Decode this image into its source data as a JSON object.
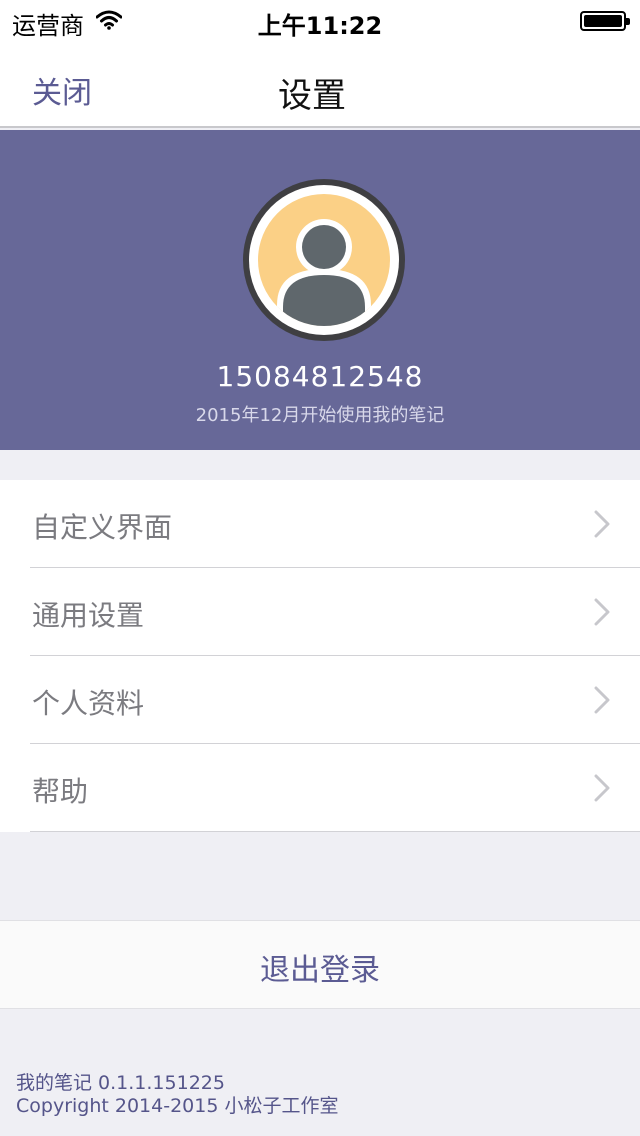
{
  "status_bar": {
    "carrier": "运营商",
    "time": "上午11:22",
    "wifi_icon": "wifi-icon",
    "battery_icon": "battery-icon"
  },
  "nav": {
    "close_label": "关闭",
    "title": "设置"
  },
  "profile": {
    "phone": "15084812548",
    "since": "2015年12月开始使用我的笔记",
    "avatar_icon": "user-avatar-icon",
    "background_color": "#676898"
  },
  "settings": {
    "items": [
      {
        "label": "自定义界面"
      },
      {
        "label": "通用设置"
      },
      {
        "label": "个人资料"
      },
      {
        "label": "帮助"
      }
    ]
  },
  "logout": {
    "label": "退出登录"
  },
  "footer": {
    "version": "我的笔记 0.1.1.151225",
    "copyright": "Copyright 2014-2015 小松子工作室"
  },
  "colors": {
    "accent": "#5b5b93",
    "header_bg": "#676898",
    "page_bg": "#efeff4"
  }
}
